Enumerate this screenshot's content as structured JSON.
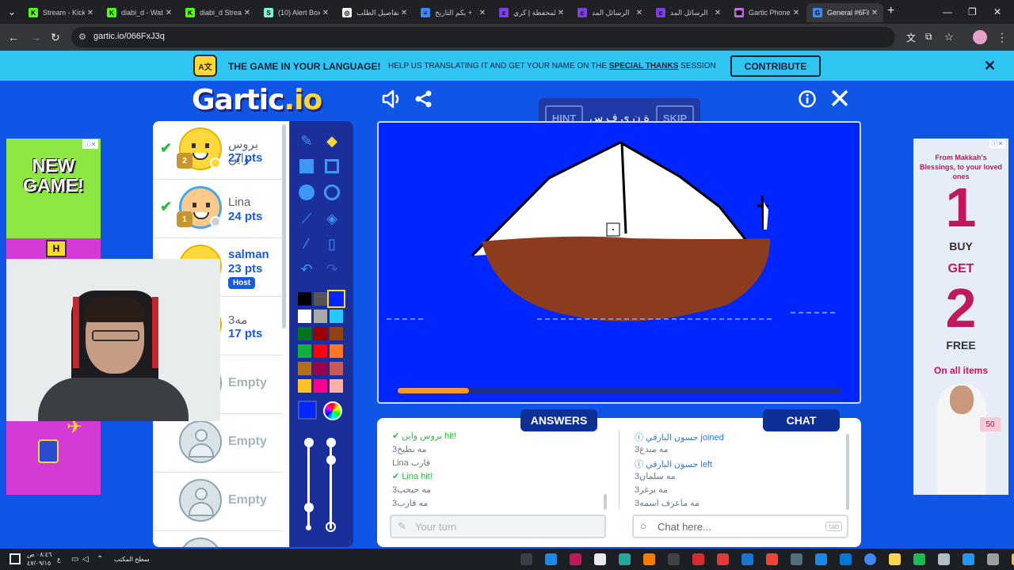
{
  "browser": {
    "tabs": [
      {
        "label": "Stream - Kick",
        "favicon": "K",
        "color": "#53fc18"
      },
      {
        "label": "diabi_d - Wat",
        "favicon": "K",
        "color": "#53fc18"
      },
      {
        "label": "diabi_d Stream",
        "favicon": "K",
        "color": "#53fc18"
      },
      {
        "label": "(10) Alert Box",
        "favicon": "S",
        "color": "#80f5d2"
      },
      {
        "label": "تفاصيل الطلب",
        "favicon": "◎",
        "color": "#ffffff"
      },
      {
        "label": "بكم التاريخ +",
        "favicon": "≡",
        "color": "#4285f4"
      },
      {
        "label": "المحفظة | كري",
        "favicon": "c",
        "color": "#7b3fe4"
      },
      {
        "label": "الرسائل المد",
        "favicon": "c",
        "color": "#7b3fe4"
      },
      {
        "label": "الرسائل المد",
        "favicon": "c",
        "color": "#7b3fe4"
      },
      {
        "label": "Gartic Phone",
        "favicon": "☎",
        "color": "#c26ee0"
      },
      {
        "label": "General #6Fil",
        "favicon": "G",
        "color": "#3b88f5"
      }
    ],
    "url": "gartic.io/066FxJ3q"
  },
  "banner": {
    "icon_text": "A文",
    "title": "THE GAME IN YOUR LANGUAGE!",
    "subtitle_pre": "HELP US TRANSLATING IT AND GET YOUR NAME ON THE ",
    "subtitle_link": "SPECIAL THANKS",
    "subtitle_post": " SESSION",
    "contribute": "CONTRIBUTE"
  },
  "logo": {
    "main": "Gartic",
    "suffix": ".io"
  },
  "hint": {
    "hint_label": "HINT",
    "word": "ة ن ي ف س",
    "skip_label": "SKIP"
  },
  "players": [
    {
      "name": "بروس واين",
      "points": "27 pts",
      "guessed": true,
      "rank": "2",
      "avatar": "yellow",
      "dot": "#fdd835"
    },
    {
      "name": "Lina",
      "points": "24 pts",
      "guessed": true,
      "rank": "1",
      "avatar": "lina",
      "dot": "#cfcfcf"
    },
    {
      "name": "salman",
      "points": "23 pts",
      "host": "Host",
      "avatar": "yellow"
    },
    {
      "name": "مه3",
      "points": "17 pts",
      "avatar": "yellow"
    },
    {
      "name": "Empty",
      "avatar": "empty"
    },
    {
      "name": "Empty",
      "avatar": "empty"
    },
    {
      "name": "Empty",
      "avatar": "empty"
    }
  ],
  "ads": {
    "left_title": "NEW GAME!",
    "right_top": "From Makkah's Blessings, to your loved ones",
    "right_num1": "1",
    "right_buy": "BUY",
    "right_get": "GET",
    "right_num2": "2",
    "right_free": "FREE",
    "right_all": "On all items",
    "right_badge": "50"
  },
  "canvas": {
    "background": "#0026ff",
    "timer_fraction": 0.16
  },
  "answers": {
    "tab_label": "ANSWERS",
    "messages": [
      {
        "text": "✔ بروس واين hit!",
        "kind": "hit"
      },
      {
        "text": "مه بطيخ3",
        "kind": "normal"
      },
      {
        "text": "Lina قارب",
        "kind": "normal"
      },
      {
        "text": "✔ Lina hit!",
        "kind": "hit"
      },
      {
        "text": "مه حيحب3",
        "kind": "normal"
      },
      {
        "text": "مه قارب3",
        "kind": "normal"
      }
    ],
    "input_placeholder": "Your turn"
  },
  "chat": {
    "tab_label": "CHAT",
    "messages": [
      {
        "text": "ⓘ حسون البارقي joined",
        "kind": "sys"
      },
      {
        "text": "مه مبدع3",
        "kind": "normal"
      },
      {
        "text": "ⓘ حسون البارقي left",
        "kind": "sys"
      },
      {
        "text": "مه سلمان3",
        "kind": "normal"
      },
      {
        "text": "مه برغر3",
        "kind": "normal"
      },
      {
        "text": "مه ماعرف اسمه3",
        "kind": "normal"
      }
    ],
    "input_placeholder": "Chat here...",
    "tab_key": "tab"
  },
  "taskbar": {
    "desktop_label": "سطح المكتب",
    "time": "٠٨:٤٦ ص",
    "date": "٤٧/٠٩/١٥",
    "lang": "ع"
  }
}
